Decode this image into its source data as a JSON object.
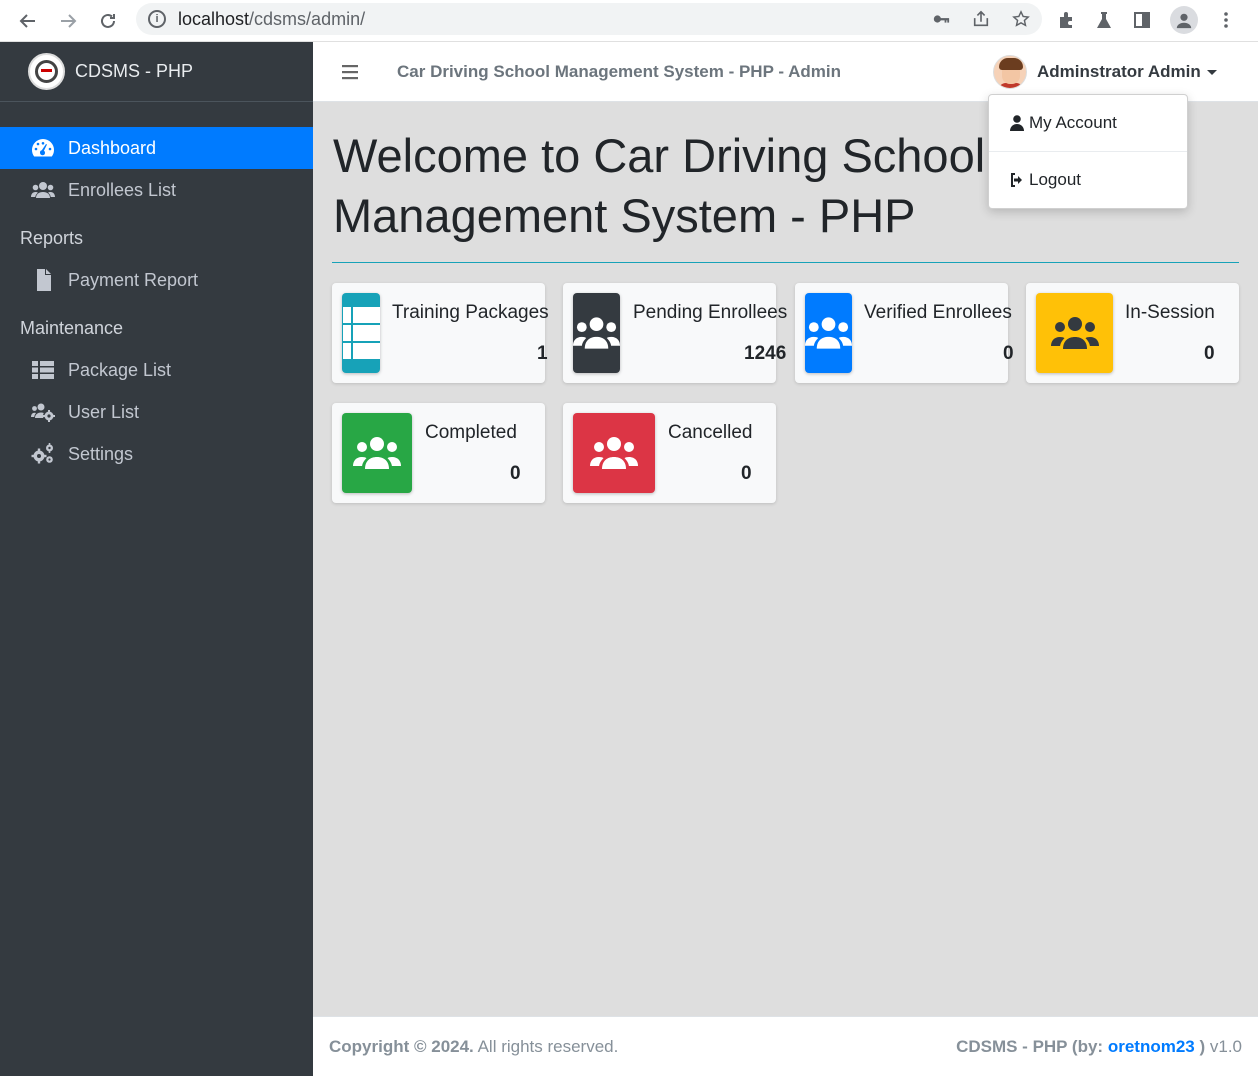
{
  "browser": {
    "url_host": "localhost",
    "url_path": "/cdsms/admin/"
  },
  "brand": {
    "name": "CDSMS - PHP"
  },
  "sidebar": {
    "items": [
      {
        "label": "Dashboard",
        "icon": "tachometer-icon",
        "active": true
      },
      {
        "label": "Enrollees List",
        "icon": "users-icon"
      }
    ],
    "reports_header": "Reports",
    "reports": [
      {
        "label": "Payment Report",
        "icon": "file-icon"
      }
    ],
    "maintenance_header": "Maintenance",
    "maintenance": [
      {
        "label": "Package List",
        "icon": "table-icon"
      },
      {
        "label": "User List",
        "icon": "users-cog-icon"
      },
      {
        "label": "Settings",
        "icon": "cogs-icon"
      }
    ]
  },
  "header": {
    "title": "Car Driving School Management System - PHP - Admin",
    "user_name": "Adminstrator Admin"
  },
  "dropdown": {
    "my_account": "My Account",
    "logout": "Logout"
  },
  "main": {
    "welcome": "Welcome to Car Driving School Management System - PHP",
    "cards": [
      {
        "label": "Training Packages",
        "value": "1",
        "color": "#17a2b8",
        "icon": "table-icon"
      },
      {
        "label": "Pending Enrollees",
        "value": "1246",
        "color": "#343a40",
        "icon": "users-icon"
      },
      {
        "label": "Verified Enrollees",
        "value": "0",
        "color": "#007bff",
        "icon": "users-icon"
      },
      {
        "label": "In-Session",
        "value": "0",
        "color": "#ffc107",
        "icon": "users-icon"
      },
      {
        "label": "Completed",
        "value": "0",
        "color": "#28a745",
        "icon": "users-icon"
      },
      {
        "label": "Cancelled",
        "value": "0",
        "color": "#dc3545",
        "icon": "users-icon"
      }
    ]
  },
  "footer": {
    "copyright": "Copyright © 2024.",
    "rights": " All rights reserved.",
    "app": "CDSMS - PHP (by: ",
    "author": "oretnom23",
    "close": " )",
    "version": " v1.0"
  }
}
